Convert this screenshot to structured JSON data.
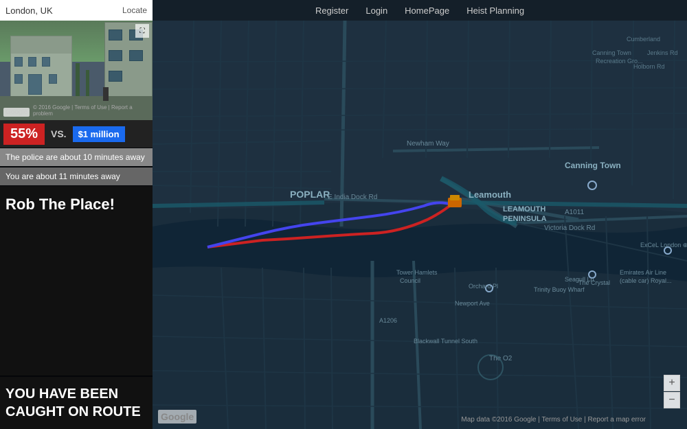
{
  "location": {
    "text": "London, UK",
    "locate_btn": "Locate"
  },
  "nav": {
    "items": [
      "Register",
      "Login",
      "HomePage",
      "Heist Planning"
    ]
  },
  "stats": {
    "percent": "55%",
    "vs": "VS.",
    "money": "$1 million"
  },
  "messages": {
    "police": "The police are about 10 minutes away",
    "you": "You are about 11 minutes away"
  },
  "rob_btn": "Rob The Place!",
  "caught": "YOU HAVE BEEN CAUGHT ON ROUTE",
  "map": {
    "copyright": "Map data ©2016 Google | Terms of Use | Report a map error",
    "google_label": "Google",
    "areas": [
      "POPLAR",
      "Leamouth",
      "LEAMOUTH PENINSULA",
      "Canning Town"
    ],
    "roads": [
      "Newham Way",
      "E India Dock Rd",
      "A1011",
      "A1206",
      "Blackwall Tunnel South",
      "Tower Hamlets Council",
      "Trinity Buoy Wharf",
      "The O2",
      "The Crystal",
      "Emirates Air Line (cable car) Royal...",
      "ExCeL London",
      "Orchard Pl",
      "Newport Ave",
      "Seagull Ln",
      "Victoria Dock Rd"
    ]
  },
  "icons": {
    "expand": "⛶",
    "zoom_in": "+",
    "zoom_out": "−"
  }
}
